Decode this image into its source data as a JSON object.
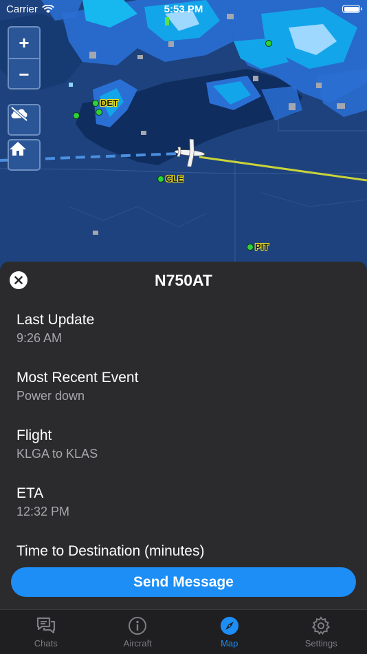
{
  "status_bar": {
    "carrier": "Carrier",
    "time": "5:53 PM"
  },
  "map": {
    "airports": [
      {
        "code": "DET"
      },
      {
        "code": "CLE"
      },
      {
        "code": "PIT"
      }
    ],
    "zoom_in_label": "+",
    "zoom_out_label": "−"
  },
  "sheet": {
    "title": "N750AT",
    "fields": [
      {
        "label": "Last Update",
        "value": "9:26 AM"
      },
      {
        "label": "Most Recent Event",
        "value": "Power down"
      },
      {
        "label": "Flight",
        "value": "KLGA to KLAS"
      },
      {
        "label": "ETA",
        "value": "12:32 PM"
      },
      {
        "label": "Time to Destination (minutes)",
        "value": ""
      }
    ],
    "send_button": "Send Message"
  },
  "tabs": [
    {
      "label": "Chats",
      "icon": "chat-icon",
      "active": false
    },
    {
      "label": "Aircraft",
      "icon": "info-icon",
      "active": false
    },
    {
      "label": "Map",
      "icon": "compass-icon",
      "active": true
    },
    {
      "label": "Settings",
      "icon": "gear-icon",
      "active": false
    }
  ],
  "colors": {
    "accent": "#1c8ef5",
    "sheet_background": "#2b2b2d",
    "route_flown": "#4a8fe0",
    "route_remaining": "#c9d33a"
  }
}
